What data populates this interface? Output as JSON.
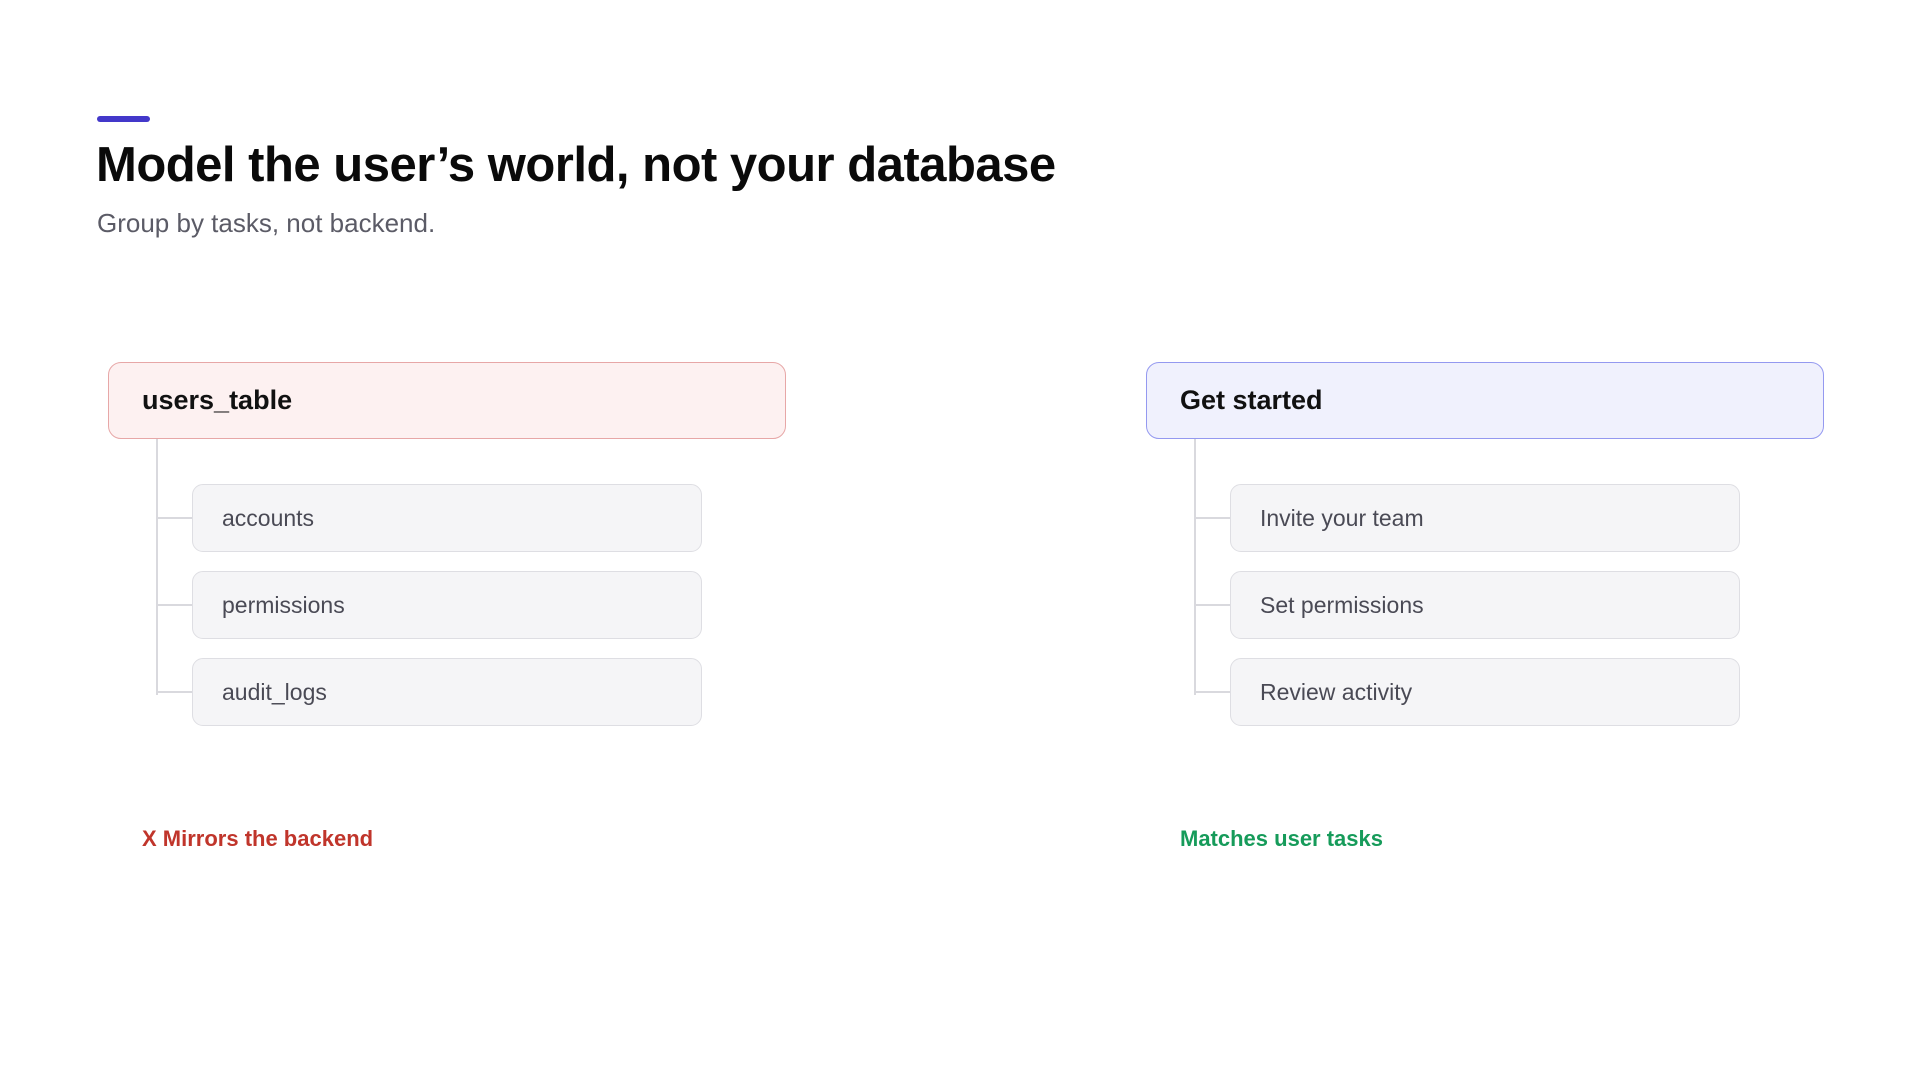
{
  "slide": {
    "title": "Model the user’s world, not your database",
    "subtitle": "Group by tasks, not backend.",
    "accent_color": "#4338ca"
  },
  "bad_example": {
    "header": "users_table",
    "items": [
      "accounts",
      "permissions",
      "audit_logs"
    ],
    "verdict": "X Mirrors the backend",
    "verdict_color": "#c0352b",
    "header_bg": "#fdf1f1",
    "header_border": "#e7a7a7"
  },
  "good_example": {
    "header": "Get started",
    "items": [
      "Invite your team",
      "Set permissions",
      "Review activity"
    ],
    "verdict": "Matches user tasks",
    "verdict_color": "#169b5a",
    "header_bg": "#f0f1fd",
    "header_border": "#9499f0"
  }
}
